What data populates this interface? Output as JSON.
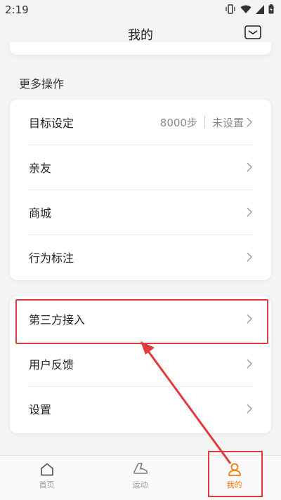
{
  "status_bar": {
    "time": "2:19"
  },
  "header": {
    "title": "我的"
  },
  "sections": {
    "more_actions_title": "更多操作"
  },
  "card1": {
    "rows": [
      {
        "label": "目标设定",
        "value": "8000步",
        "extra": "未设置"
      },
      {
        "label": "亲友"
      },
      {
        "label": "商城"
      },
      {
        "label": "行为标注"
      }
    ]
  },
  "card2": {
    "rows": [
      {
        "label": "第三方接入"
      },
      {
        "label": "用户反馈"
      },
      {
        "label": "设置"
      }
    ]
  },
  "tabbar": {
    "tabs": [
      {
        "label": "首页",
        "icon": "home-icon"
      },
      {
        "label": "运动",
        "icon": "shoe-icon"
      },
      {
        "label": "我的",
        "icon": "person-icon"
      }
    ],
    "active_color": "#f27a10",
    "inactive_color": "#999999"
  },
  "annotation_color": "#e23a3a"
}
